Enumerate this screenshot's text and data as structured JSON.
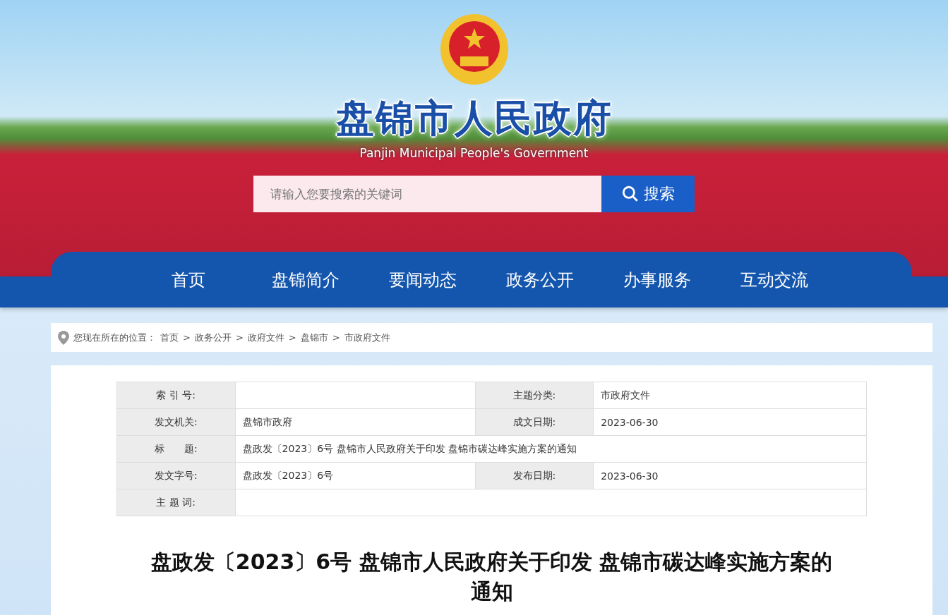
{
  "header": {
    "site_title": "盘锦市人民政府",
    "site_subtitle": "Panjin Municipal People's Government",
    "search": {
      "placeholder": "请输入您要搜索的关键词",
      "button": "搜索"
    }
  },
  "nav": [
    {
      "label": "首页"
    },
    {
      "label": "盘锦简介"
    },
    {
      "label": "要闻动态"
    },
    {
      "label": "政务公开"
    },
    {
      "label": "办事服务"
    },
    {
      "label": "互动交流"
    }
  ],
  "breadcrumb": {
    "prefix": "您现在所在的位置：",
    "separator": ">",
    "items": [
      "首页",
      "政务公开",
      "政府文件",
      "盘锦市",
      "市政府文件"
    ]
  },
  "info_table": [
    {
      "cells": [
        {
          "label": "索 引 号:"
        },
        {
          "label": "主题分类:",
          "value": "市政府文件"
        }
      ]
    },
    {
      "cells": [
        {
          "label": "发文机关:",
          "value": "盘锦市政府"
        },
        {
          "label": "成文日期:",
          "value": "2023-06-30"
        }
      ]
    },
    {
      "cells": [
        {
          "label": "标　　题:",
          "value": "盘政发〔2023〕6号 盘锦市人民政府关于印发 盘锦市碳达峰实施方案的通知"
        }
      ]
    },
    {
      "cells": [
        {
          "label": "发文字号:",
          "value": "盘政发〔2023〕6号"
        },
        {
          "label": "发布日期:",
          "value": "2023-06-30"
        }
      ]
    },
    {
      "cells": [
        {
          "label": "主 题 词:"
        }
      ]
    }
  ],
  "article_title": "盘政发〔2023〕6号 盘锦市人民政府关于印发 盘锦市碳达峰实施方案的通知"
}
